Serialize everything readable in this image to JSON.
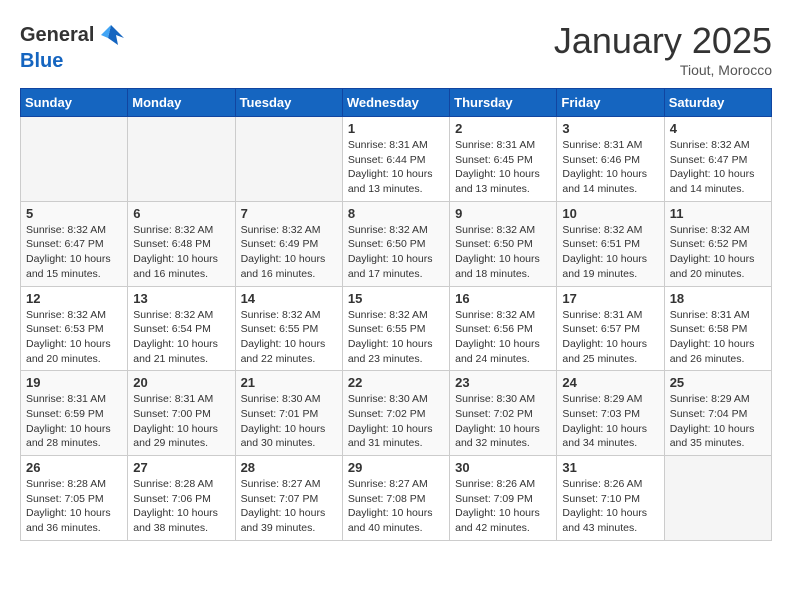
{
  "logo": {
    "general": "General",
    "blue": "Blue"
  },
  "title": "January 2025",
  "location": "Tiout, Morocco",
  "weekdays": [
    "Sunday",
    "Monday",
    "Tuesday",
    "Wednesday",
    "Thursday",
    "Friday",
    "Saturday"
  ],
  "weeks": [
    [
      {
        "day": "",
        "info": ""
      },
      {
        "day": "",
        "info": ""
      },
      {
        "day": "",
        "info": ""
      },
      {
        "day": "1",
        "info": "Sunrise: 8:31 AM\nSunset: 6:44 PM\nDaylight: 10 hours\nand 13 minutes."
      },
      {
        "day": "2",
        "info": "Sunrise: 8:31 AM\nSunset: 6:45 PM\nDaylight: 10 hours\nand 13 minutes."
      },
      {
        "day": "3",
        "info": "Sunrise: 8:31 AM\nSunset: 6:46 PM\nDaylight: 10 hours\nand 14 minutes."
      },
      {
        "day": "4",
        "info": "Sunrise: 8:32 AM\nSunset: 6:47 PM\nDaylight: 10 hours\nand 14 minutes."
      }
    ],
    [
      {
        "day": "5",
        "info": "Sunrise: 8:32 AM\nSunset: 6:47 PM\nDaylight: 10 hours\nand 15 minutes."
      },
      {
        "day": "6",
        "info": "Sunrise: 8:32 AM\nSunset: 6:48 PM\nDaylight: 10 hours\nand 16 minutes."
      },
      {
        "day": "7",
        "info": "Sunrise: 8:32 AM\nSunset: 6:49 PM\nDaylight: 10 hours\nand 16 minutes."
      },
      {
        "day": "8",
        "info": "Sunrise: 8:32 AM\nSunset: 6:50 PM\nDaylight: 10 hours\nand 17 minutes."
      },
      {
        "day": "9",
        "info": "Sunrise: 8:32 AM\nSunset: 6:50 PM\nDaylight: 10 hours\nand 18 minutes."
      },
      {
        "day": "10",
        "info": "Sunrise: 8:32 AM\nSunset: 6:51 PM\nDaylight: 10 hours\nand 19 minutes."
      },
      {
        "day": "11",
        "info": "Sunrise: 8:32 AM\nSunset: 6:52 PM\nDaylight: 10 hours\nand 20 minutes."
      }
    ],
    [
      {
        "day": "12",
        "info": "Sunrise: 8:32 AM\nSunset: 6:53 PM\nDaylight: 10 hours\nand 20 minutes."
      },
      {
        "day": "13",
        "info": "Sunrise: 8:32 AM\nSunset: 6:54 PM\nDaylight: 10 hours\nand 21 minutes."
      },
      {
        "day": "14",
        "info": "Sunrise: 8:32 AM\nSunset: 6:55 PM\nDaylight: 10 hours\nand 22 minutes."
      },
      {
        "day": "15",
        "info": "Sunrise: 8:32 AM\nSunset: 6:55 PM\nDaylight: 10 hours\nand 23 minutes."
      },
      {
        "day": "16",
        "info": "Sunrise: 8:32 AM\nSunset: 6:56 PM\nDaylight: 10 hours\nand 24 minutes."
      },
      {
        "day": "17",
        "info": "Sunrise: 8:31 AM\nSunset: 6:57 PM\nDaylight: 10 hours\nand 25 minutes."
      },
      {
        "day": "18",
        "info": "Sunrise: 8:31 AM\nSunset: 6:58 PM\nDaylight: 10 hours\nand 26 minutes."
      }
    ],
    [
      {
        "day": "19",
        "info": "Sunrise: 8:31 AM\nSunset: 6:59 PM\nDaylight: 10 hours\nand 28 minutes."
      },
      {
        "day": "20",
        "info": "Sunrise: 8:31 AM\nSunset: 7:00 PM\nDaylight: 10 hours\nand 29 minutes."
      },
      {
        "day": "21",
        "info": "Sunrise: 8:30 AM\nSunset: 7:01 PM\nDaylight: 10 hours\nand 30 minutes."
      },
      {
        "day": "22",
        "info": "Sunrise: 8:30 AM\nSunset: 7:02 PM\nDaylight: 10 hours\nand 31 minutes."
      },
      {
        "day": "23",
        "info": "Sunrise: 8:30 AM\nSunset: 7:02 PM\nDaylight: 10 hours\nand 32 minutes."
      },
      {
        "day": "24",
        "info": "Sunrise: 8:29 AM\nSunset: 7:03 PM\nDaylight: 10 hours\nand 34 minutes."
      },
      {
        "day": "25",
        "info": "Sunrise: 8:29 AM\nSunset: 7:04 PM\nDaylight: 10 hours\nand 35 minutes."
      }
    ],
    [
      {
        "day": "26",
        "info": "Sunrise: 8:28 AM\nSunset: 7:05 PM\nDaylight: 10 hours\nand 36 minutes."
      },
      {
        "day": "27",
        "info": "Sunrise: 8:28 AM\nSunset: 7:06 PM\nDaylight: 10 hours\nand 38 minutes."
      },
      {
        "day": "28",
        "info": "Sunrise: 8:27 AM\nSunset: 7:07 PM\nDaylight: 10 hours\nand 39 minutes."
      },
      {
        "day": "29",
        "info": "Sunrise: 8:27 AM\nSunset: 7:08 PM\nDaylight: 10 hours\nand 40 minutes."
      },
      {
        "day": "30",
        "info": "Sunrise: 8:26 AM\nSunset: 7:09 PM\nDaylight: 10 hours\nand 42 minutes."
      },
      {
        "day": "31",
        "info": "Sunrise: 8:26 AM\nSunset: 7:10 PM\nDaylight: 10 hours\nand 43 minutes."
      },
      {
        "day": "",
        "info": ""
      }
    ]
  ]
}
